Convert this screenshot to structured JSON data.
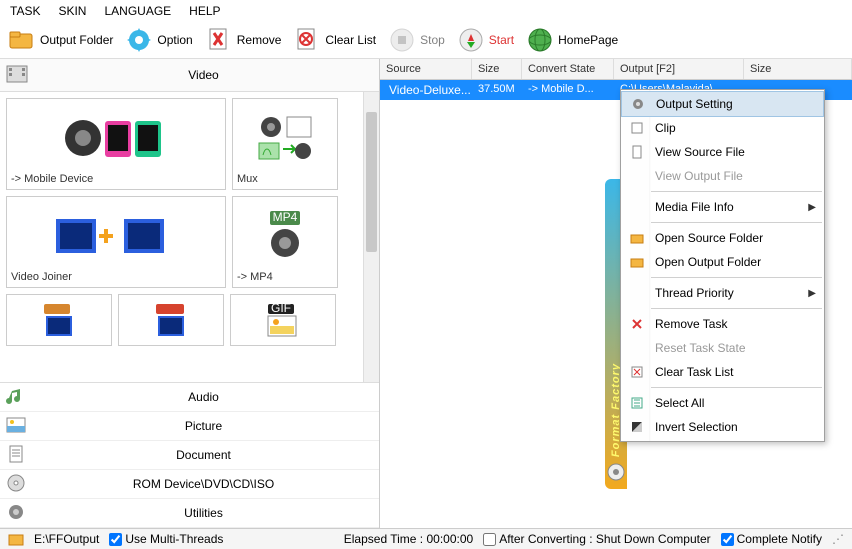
{
  "menu": {
    "task": "TASK",
    "skin": "SKIN",
    "language": "LANGUAGE",
    "help": "HELP"
  },
  "toolbar": {
    "output_folder": "Output Folder",
    "option": "Option",
    "remove": "Remove",
    "clear_list": "Clear List",
    "stop": "Stop",
    "start": "Start",
    "homepage": "HomePage"
  },
  "left": {
    "video_header": "Video",
    "tiles": {
      "mobile": "-> Mobile Device",
      "mux": "Mux",
      "joiner": "Video Joiner",
      "mp4": "-> MP4"
    },
    "categories": {
      "audio": "Audio",
      "picture": "Picture",
      "document": "Document",
      "rom": "ROM Device\\DVD\\CD\\ISO",
      "utilities": "Utilities"
    }
  },
  "grid": {
    "headers": {
      "source": "Source",
      "size": "Size",
      "state": "Convert State",
      "output": "Output [F2]",
      "size2": "Size"
    },
    "row": {
      "source": "Video-Deluxe...",
      "size": "37.50M",
      "state": "-> Mobile D...",
      "output": "C:\\Users\\Malavida\\"
    }
  },
  "context": {
    "output_setting": "Output Setting",
    "clip": "Clip",
    "view_source": "View Source File",
    "view_output": "View Output File",
    "media_info": "Media File Info",
    "open_source": "Open Source Folder",
    "open_output": "Open Output Folder",
    "thread_priority": "Thread Priority",
    "remove_task": "Remove Task",
    "reset_state": "Reset Task State",
    "clear_list": "Clear Task List",
    "select_all": "Select All",
    "invert_selection": "Invert Selection"
  },
  "brand": "Format Factory",
  "status": {
    "output_path": "E:\\FFOutput",
    "multi_threads": "Use Multi-Threads",
    "elapsed": "Elapsed Time : 00:00:00",
    "after_converting": "After Converting : Shut Down Computer",
    "complete_notify": "Complete Notify"
  }
}
